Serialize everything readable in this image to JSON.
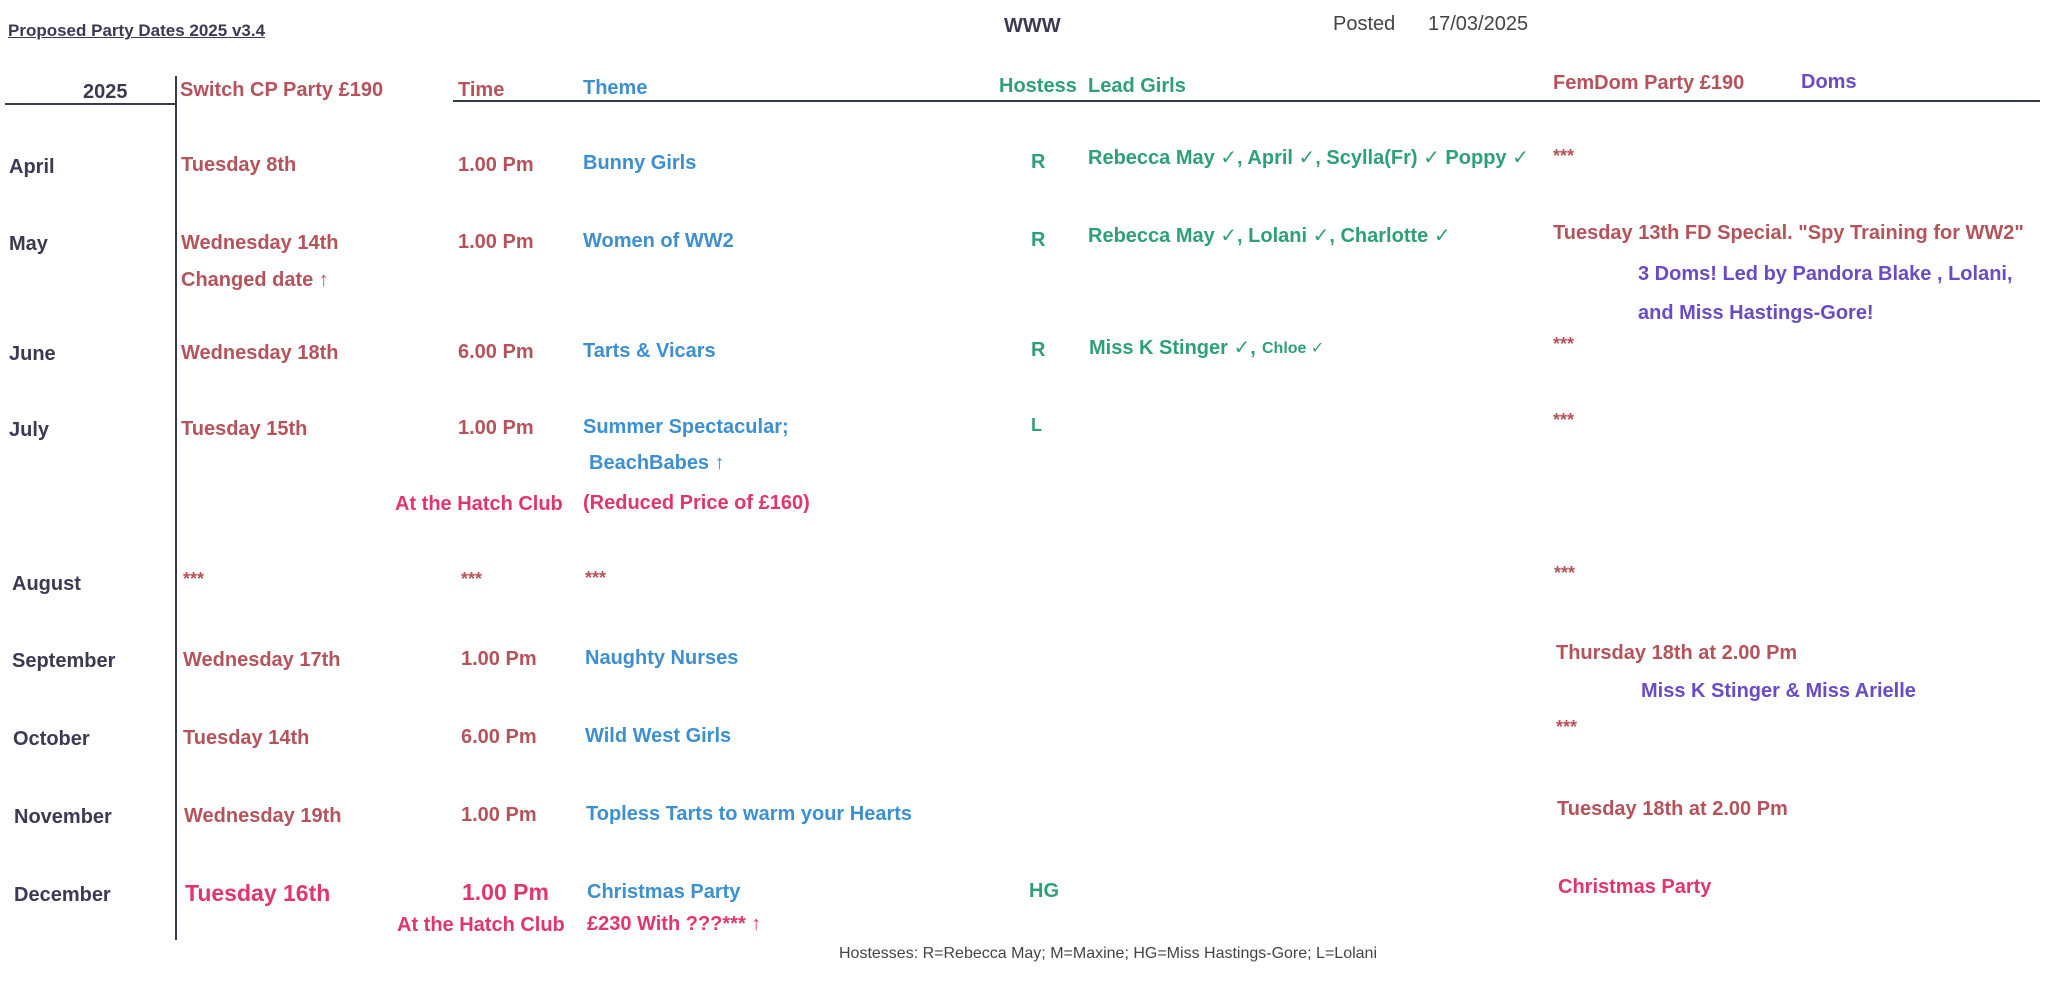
{
  "header": {
    "title": "Proposed Party Dates 2025 v3.4",
    "site": "WWW",
    "posted_label": "Posted",
    "posted_date": "17/03/2025"
  },
  "columns": {
    "year": "2025",
    "switch": "Switch CP Party £190",
    "time": "Time",
    "theme": "Theme",
    "hostess": "Hostess",
    "lead": "Lead Girls",
    "femdom": "FemDom Party £190",
    "doms": "Doms"
  },
  "rows": [
    {
      "month": "April",
      "date": "Tuesday 8th",
      "time": "1.00 Pm",
      "theme": "Bunny Girls",
      "hostess": "R",
      "lead": "Rebecca May ✓, April ✓, Scylla(Fr) ✓ Poppy ✓",
      "femdom": "***"
    },
    {
      "month": "May",
      "date": "Wednesday 14th",
      "date_note": "Changed date  ↑",
      "time": "1.00 Pm",
      "theme": "Women of WW2",
      "hostess": "R",
      "lead": "Rebecca May ✓, Lolani ✓, Charlotte ✓",
      "femdom": "Tuesday 13th FD Special. \"Spy Training for WW2\"",
      "doms_1": "3 Doms! Led by Pandora Blake , Lolani,",
      "doms_2": "and Miss Hastings-Gore!"
    },
    {
      "month": "June",
      "date": "Wednesday 18th",
      "time": "6.00 Pm",
      "theme": "Tarts & Vicars",
      "hostess": "R",
      "lead": "Miss K Stinger ✓,",
      "lead_extra": "Chloe ✓",
      "femdom": "***"
    },
    {
      "month": "July",
      "date": "Tuesday 15th",
      "time": "1.00 Pm",
      "theme": "Summer Spectacular;",
      "theme_2": "BeachBabes ↑",
      "venue": "At the Hatch Club",
      "price_note": "(Reduced Price of £160)",
      "hostess": "L",
      "femdom": "***"
    },
    {
      "month": "August",
      "date": "***",
      "time": "***",
      "theme": "***",
      "femdom": "***"
    },
    {
      "month": "September",
      "date": "Wednesday 17th",
      "time": "1.00 Pm",
      "theme": "Naughty Nurses",
      "femdom": "Thursday 18th at 2.00 Pm",
      "doms_1": "Miss K Stinger & Miss Arielle"
    },
    {
      "month": "October",
      "date": "Tuesday 14th",
      "time": "6.00 Pm",
      "theme": "Wild West Girls",
      "femdom": "***"
    },
    {
      "month": "November",
      "date": "Wednesday 19th",
      "time": "1.00 Pm",
      "theme": "Topless Tarts to warm your Hearts",
      "femdom": "Tuesday 18th at 2.00 Pm"
    },
    {
      "month": "December",
      "date": "Tuesday 16th",
      "time": "1.00 Pm",
      "theme": "Christmas Party",
      "venue": "At the Hatch Club",
      "price_note": "£230 With ???*** ↑",
      "hostess": "HG",
      "femdom": "Christmas Party"
    }
  ],
  "footer": {
    "legend": "Hostesses: R=Rebecca May; M=Maxine; HG=Miss Hastings-Gore; L=Lolani"
  }
}
